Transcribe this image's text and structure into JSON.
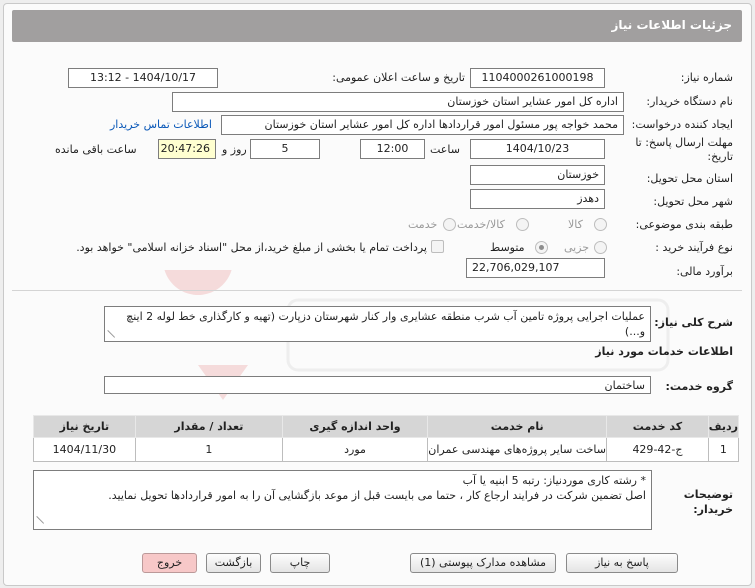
{
  "header": {
    "title": "جزئیات اطلاعات نیاز"
  },
  "fields": {
    "need_number_label": "شماره نیاز:",
    "need_number": "1104000261000198",
    "announce_label": "تاریخ و ساعت اعلان عمومی:",
    "announce_value": "1404/10/17 - 13:12",
    "buyer_label": "نام دستگاه خریدار:",
    "buyer_value": "اداره کل امور عشایر استان خوزستان",
    "creator_label": "ایجاد کننده درخواست:",
    "creator_value": "محمد خواجه پور مسئول امور قراردادها اداره کل امور عشایر استان خوزستان",
    "contact_link": "اطلاعات تماس خریدار",
    "deadline_label": "مهلت ارسال پاسخ: تا تاریخ:",
    "deadline_date": "1404/10/23",
    "time_label": "ساعت",
    "deadline_time": "12:00",
    "days_value": "5",
    "days_label": "روز و",
    "remaining_value": "20:47:26",
    "remaining_label": "ساعت باقی مانده",
    "province_label": "استان محل تحویل:",
    "province_value": "خوزستان",
    "city_label": "شهر محل تحویل:",
    "city_value": "دهدز",
    "category_label": "طبقه بندی موضوعی:",
    "category_options": [
      "کالا",
      "کالا/خدمت",
      "خدمت"
    ],
    "process_label": "نوع فرآیند خرید :",
    "process_options": [
      "جزیی",
      "متوسط"
    ],
    "payment_note": "پرداخت تمام یا بخشی از مبلغ خرید،از محل \"اسناد خزانه اسلامی\" خواهد بود.",
    "estimate_label": "برآورد مالی:",
    "estimate_value": "22,706,029,107"
  },
  "description": {
    "label": "شرح کلی نیاز:",
    "text": "عملیات اجرایی پروژه تامین آب شرب منطقه عشایری وار کنار شهرستان دزپارت (تهیه و کارگذاری خط لوله 2 اینچ و...)"
  },
  "services": {
    "section_title": "اطلاعات خدمات مورد نیاز",
    "group_label": "گروه خدمت:",
    "group_value": "ساختمان"
  },
  "table": {
    "headers": [
      "ردیف",
      "کد خدمت",
      "نام خدمت",
      "واحد اندازه گیری",
      "تعداد / مقدار",
      "تاریخ نیاز"
    ],
    "rows": [
      [
        "1",
        "ج-42-429",
        "ساخت سایر پروژه‌های مهندسی عمران",
        "مورد",
        "1",
        "1404/11/30"
      ]
    ]
  },
  "buyer_notes": {
    "label": "توضیحات خریدار:",
    "line1": "* رشته کاری موردنیاز:   رتبه 5  ابنیه یا آب",
    "line2": "اصل تضمین شرکت در فرایند ارجاع کار ،   حتما می بایست قبل از موعد بازگشایی  آن را به امور قراردادها تحویل نمایید."
  },
  "buttons": {
    "reply": "پاسخ به نیاز",
    "view_docs": "مشاهده مدارک پیوستی (1)",
    "print": "چاپ",
    "back": "بازگشت",
    "exit": "خروج"
  },
  "colors": {
    "titlebar": "#a19f9f",
    "link": "#0a58b8",
    "remaining_bg": "#ffffd0",
    "exit_bg": "#f7c8c8"
  }
}
